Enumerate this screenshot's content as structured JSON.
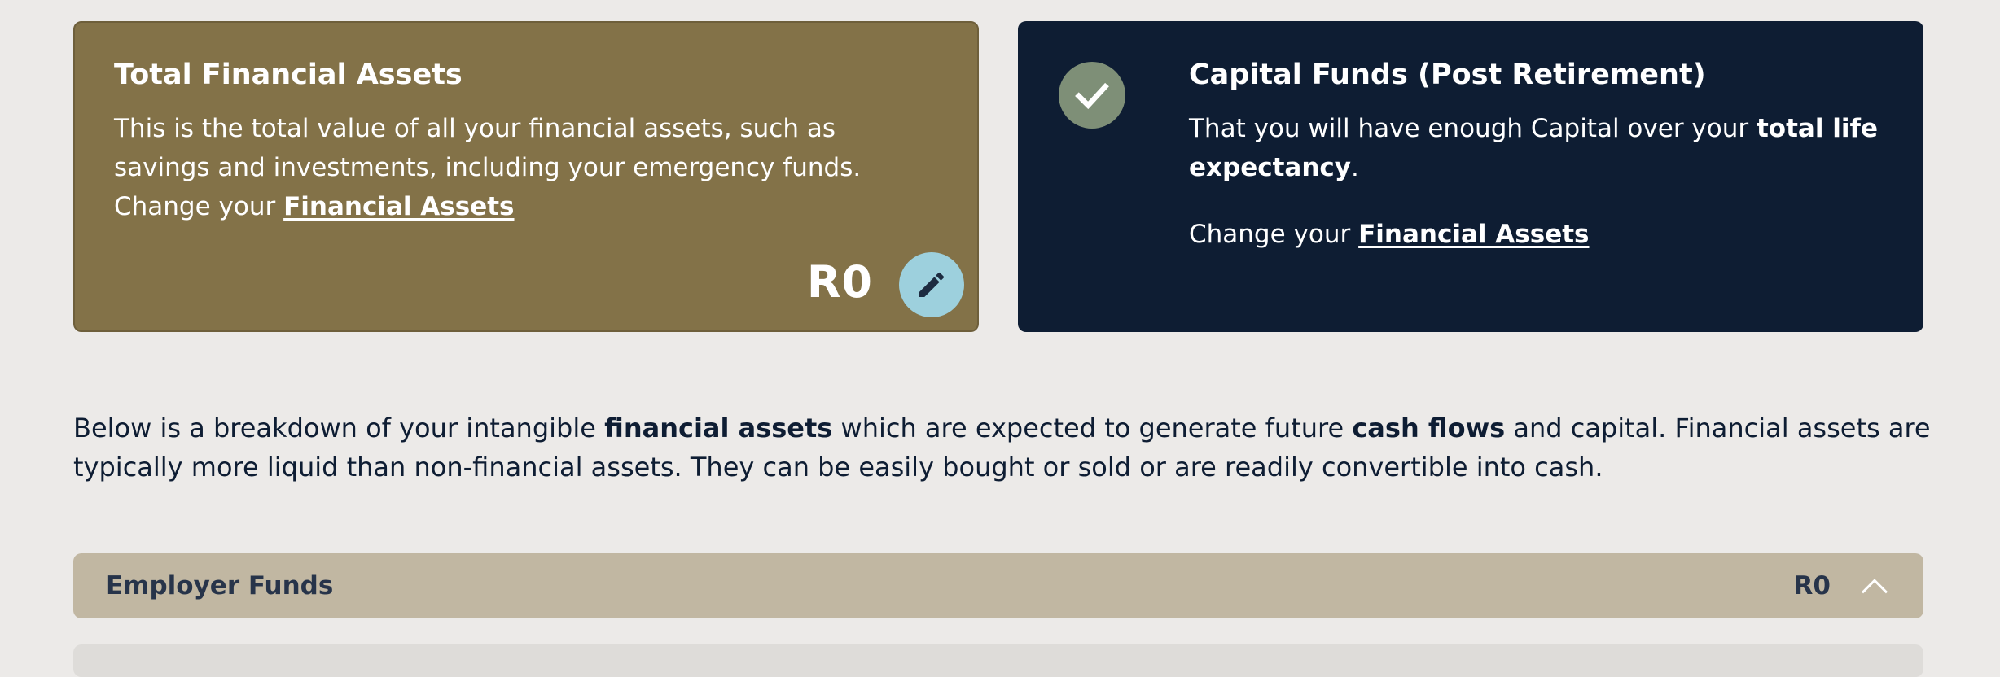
{
  "assets_card": {
    "title": "Total Financial Assets",
    "text_prefix": "This is the total value of all your financial assets, such as savings and investments, including your emergency funds. Change your ",
    "link": "Financial Assets",
    "amount": "R0",
    "edit_icon": "pencil-icon",
    "background": "#837248"
  },
  "capital_card": {
    "title": "Capital Funds (Post Retirement)",
    "text_prefix": "That you will have enough Capital over your ",
    "text_bold": "total life expectancy",
    "text_suffix": ".",
    "change_prefix": "Change your ",
    "link": "Financial Assets",
    "status_icon": "check-icon",
    "background": "#0e1d33"
  },
  "breakdown": {
    "part1": "Below is a breakdown of your intangible ",
    "bold1": "financial assets",
    "part2": " which are expected to generate future ",
    "bold2": "cash flows",
    "part3": " and capital. Financial assets are typically more liquid than non-financial assets. They can be easily bought or sold or are readily convertible into cash."
  },
  "accordion": {
    "title": "Employer Funds",
    "amount": "R0",
    "state_icon": "chevron-up-icon",
    "background": "#c1b7a2"
  }
}
